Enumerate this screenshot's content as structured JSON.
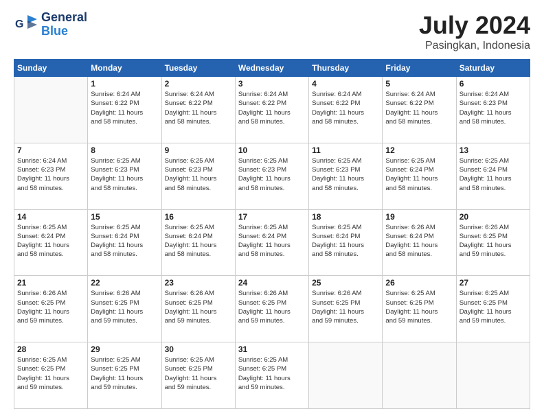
{
  "header": {
    "logo_line1": "General",
    "logo_line2": "Blue",
    "title": "July 2024",
    "subtitle": "Pasingkan, Indonesia"
  },
  "calendar": {
    "days_of_week": [
      "Sunday",
      "Monday",
      "Tuesday",
      "Wednesday",
      "Thursday",
      "Friday",
      "Saturday"
    ],
    "weeks": [
      [
        {
          "day": "",
          "info": ""
        },
        {
          "day": "1",
          "info": "Sunrise: 6:24 AM\nSunset: 6:22 PM\nDaylight: 11 hours\nand 58 minutes."
        },
        {
          "day": "2",
          "info": "Sunrise: 6:24 AM\nSunset: 6:22 PM\nDaylight: 11 hours\nand 58 minutes."
        },
        {
          "day": "3",
          "info": "Sunrise: 6:24 AM\nSunset: 6:22 PM\nDaylight: 11 hours\nand 58 minutes."
        },
        {
          "day": "4",
          "info": "Sunrise: 6:24 AM\nSunset: 6:22 PM\nDaylight: 11 hours\nand 58 minutes."
        },
        {
          "day": "5",
          "info": "Sunrise: 6:24 AM\nSunset: 6:22 PM\nDaylight: 11 hours\nand 58 minutes."
        },
        {
          "day": "6",
          "info": "Sunrise: 6:24 AM\nSunset: 6:23 PM\nDaylight: 11 hours\nand 58 minutes."
        }
      ],
      [
        {
          "day": "7",
          "info": "Sunrise: 6:24 AM\nSunset: 6:23 PM\nDaylight: 11 hours\nand 58 minutes."
        },
        {
          "day": "8",
          "info": "Sunrise: 6:25 AM\nSunset: 6:23 PM\nDaylight: 11 hours\nand 58 minutes."
        },
        {
          "day": "9",
          "info": "Sunrise: 6:25 AM\nSunset: 6:23 PM\nDaylight: 11 hours\nand 58 minutes."
        },
        {
          "day": "10",
          "info": "Sunrise: 6:25 AM\nSunset: 6:23 PM\nDaylight: 11 hours\nand 58 minutes."
        },
        {
          "day": "11",
          "info": "Sunrise: 6:25 AM\nSunset: 6:23 PM\nDaylight: 11 hours\nand 58 minutes."
        },
        {
          "day": "12",
          "info": "Sunrise: 6:25 AM\nSunset: 6:24 PM\nDaylight: 11 hours\nand 58 minutes."
        },
        {
          "day": "13",
          "info": "Sunrise: 6:25 AM\nSunset: 6:24 PM\nDaylight: 11 hours\nand 58 minutes."
        }
      ],
      [
        {
          "day": "14",
          "info": "Sunrise: 6:25 AM\nSunset: 6:24 PM\nDaylight: 11 hours\nand 58 minutes."
        },
        {
          "day": "15",
          "info": "Sunrise: 6:25 AM\nSunset: 6:24 PM\nDaylight: 11 hours\nand 58 minutes."
        },
        {
          "day": "16",
          "info": "Sunrise: 6:25 AM\nSunset: 6:24 PM\nDaylight: 11 hours\nand 58 minutes."
        },
        {
          "day": "17",
          "info": "Sunrise: 6:25 AM\nSunset: 6:24 PM\nDaylight: 11 hours\nand 58 minutes."
        },
        {
          "day": "18",
          "info": "Sunrise: 6:25 AM\nSunset: 6:24 PM\nDaylight: 11 hours\nand 58 minutes."
        },
        {
          "day": "19",
          "info": "Sunrise: 6:26 AM\nSunset: 6:24 PM\nDaylight: 11 hours\nand 58 minutes."
        },
        {
          "day": "20",
          "info": "Sunrise: 6:26 AM\nSunset: 6:25 PM\nDaylight: 11 hours\nand 59 minutes."
        }
      ],
      [
        {
          "day": "21",
          "info": "Sunrise: 6:26 AM\nSunset: 6:25 PM\nDaylight: 11 hours\nand 59 minutes."
        },
        {
          "day": "22",
          "info": "Sunrise: 6:26 AM\nSunset: 6:25 PM\nDaylight: 11 hours\nand 59 minutes."
        },
        {
          "day": "23",
          "info": "Sunrise: 6:26 AM\nSunset: 6:25 PM\nDaylight: 11 hours\nand 59 minutes."
        },
        {
          "day": "24",
          "info": "Sunrise: 6:26 AM\nSunset: 6:25 PM\nDaylight: 11 hours\nand 59 minutes."
        },
        {
          "day": "25",
          "info": "Sunrise: 6:26 AM\nSunset: 6:25 PM\nDaylight: 11 hours\nand 59 minutes."
        },
        {
          "day": "26",
          "info": "Sunrise: 6:25 AM\nSunset: 6:25 PM\nDaylight: 11 hours\nand 59 minutes."
        },
        {
          "day": "27",
          "info": "Sunrise: 6:25 AM\nSunset: 6:25 PM\nDaylight: 11 hours\nand 59 minutes."
        }
      ],
      [
        {
          "day": "28",
          "info": "Sunrise: 6:25 AM\nSunset: 6:25 PM\nDaylight: 11 hours\nand 59 minutes."
        },
        {
          "day": "29",
          "info": "Sunrise: 6:25 AM\nSunset: 6:25 PM\nDaylight: 11 hours\nand 59 minutes."
        },
        {
          "day": "30",
          "info": "Sunrise: 6:25 AM\nSunset: 6:25 PM\nDaylight: 11 hours\nand 59 minutes."
        },
        {
          "day": "31",
          "info": "Sunrise: 6:25 AM\nSunset: 6:25 PM\nDaylight: 11 hours\nand 59 minutes."
        },
        {
          "day": "",
          "info": ""
        },
        {
          "day": "",
          "info": ""
        },
        {
          "day": "",
          "info": ""
        }
      ]
    ]
  }
}
